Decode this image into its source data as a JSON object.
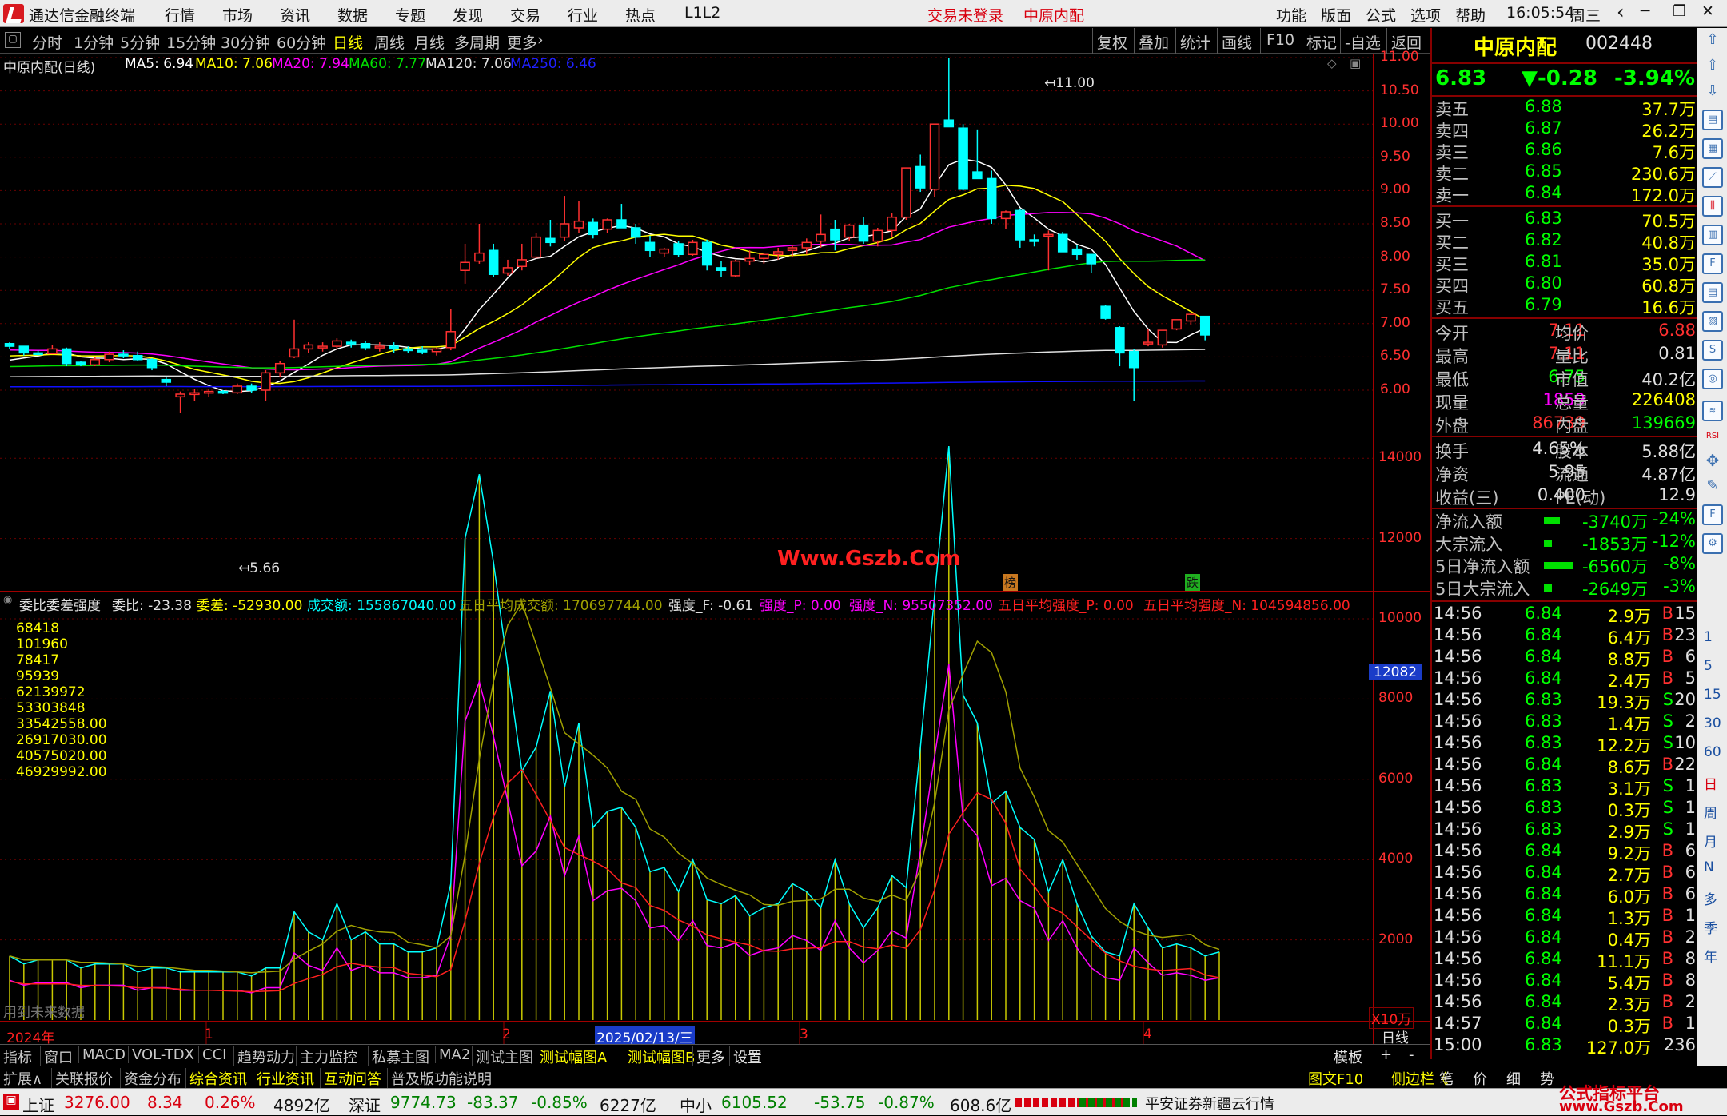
{
  "app": {
    "title": "通达信金融终端",
    "menu": [
      "行情",
      "市场",
      "资讯",
      "数据",
      "专题",
      "发现",
      "交易",
      "行业",
      "热点",
      "L1L2"
    ],
    "login": "交易未登录",
    "stock_tab": "中原内配",
    "right_menu": [
      "功能",
      "版面",
      "公式",
      "选项",
      "帮助"
    ],
    "time": "16:05:54",
    "weekday": "周三"
  },
  "periods": [
    "分时",
    "1分钟",
    "5分钟",
    "15分钟",
    "30分钟",
    "60分钟",
    "日线",
    "周线",
    "月线",
    "多周期",
    "更多"
  ],
  "tools": [
    "复权",
    "叠加",
    "统计",
    "画线",
    "F10",
    "标记",
    "-自选",
    "返回"
  ],
  "ma": {
    "name": "中原内配(日线)",
    "items": [
      {
        "t": "MA5: 6.94",
        "c": "#ffffff"
      },
      {
        "t": "MA10: 7.06",
        "c": "#ffff00"
      },
      {
        "t": "MA20: 7.94",
        "c": "#ff00ff"
      },
      {
        "t": "MA60: 7.77",
        "c": "#00e000"
      },
      {
        "t": "MA120: 7.06",
        "c": "#e0e0e0"
      },
      {
        "t": "MA250: 6.46",
        "c": "#1010ff"
      }
    ]
  },
  "price_axis": [
    "11.00",
    "10.50",
    "10.00",
    "9.50",
    "9.00",
    "8.50",
    "8.00",
    "7.50",
    "7.00",
    "6.50",
    "6.00"
  ],
  "annot": {
    "high": "11.00",
    "low": "5.66",
    "watermark": "Www.Gszb.Com",
    "mark1": "榜",
    "mark2": "跌"
  },
  "ind": {
    "name": "委比委差强度",
    "items": [
      {
        "t": "委比: -23.38",
        "c": "#e0e0e0"
      },
      {
        "t": "委差: -52930.00",
        "c": "#ffff00"
      },
      {
        "t": "成交额: 155867040.00",
        "c": "#00ffff"
      },
      {
        "t": "五日平均成交额: 170697744.00",
        "c": "#a0a000"
      },
      {
        "t": "强度_F: -0.61",
        "c": "#e0e0e0"
      },
      {
        "t": "强度_P: 0.00",
        "c": "#ff00ff"
      },
      {
        "t": "强度_N: 95507352.00",
        "c": "#ff00ff"
      },
      {
        "t": "五日平均强度_P: 0.00",
        "c": "#ff2020"
      },
      {
        "t": "五日平均强度_N: 104594856.00",
        "c": "#ff2020"
      }
    ]
  },
  "ind_values": [
    "68418",
    "101960",
    "78417",
    "95939",
    "62139972",
    "53303848",
    "33542558.00",
    "26917030.00",
    "40575020.00",
    "46929992.00"
  ],
  "vol_axis": [
    "14000",
    "12000",
    "10000",
    "8000",
    "6000",
    "4000",
    "2000"
  ],
  "vol_marker": "12082",
  "vol_unit": "X10万",
  "no_data": "用到未来数据",
  "date_axis": {
    "year": "2024年",
    "m1": "1",
    "m2": "2",
    "date": "2025/02/13/三",
    "m3": "3",
    "m4": "4",
    "period": "日线"
  },
  "stock": {
    "name": "中原内配",
    "code": "002448",
    "price": "6.83",
    "change": "▼-0.28",
    "pct": "-3.94%"
  },
  "asks": [
    [
      "卖五",
      "6.88",
      "37.7万"
    ],
    [
      "卖四",
      "6.87",
      "26.2万"
    ],
    [
      "卖三",
      "6.86",
      "7.6万"
    ],
    [
      "卖二",
      "6.85",
      "230.6万"
    ],
    [
      "卖一",
      "6.84",
      "172.0万"
    ]
  ],
  "bids": [
    [
      "买一",
      "6.83",
      "70.5万"
    ],
    [
      "买二",
      "6.82",
      "40.8万"
    ],
    [
      "买三",
      "6.81",
      "35.0万"
    ],
    [
      "买四",
      "6.80",
      "60.8万"
    ],
    [
      "买五",
      "6.79",
      "16.6万"
    ]
  ],
  "quote": [
    [
      "今开",
      "7.11",
      "均价",
      "6.88"
    ],
    [
      "最高",
      "7.11",
      "量比",
      "0.81"
    ],
    [
      "最低",
      "6.75",
      "市值",
      "40.2亿"
    ],
    [
      "现量",
      "1859",
      "总量",
      "226408"
    ],
    [
      "外盘",
      "86739",
      "内盘",
      "139669"
    ]
  ],
  "fund": [
    [
      "换手",
      "4.65%",
      "股本",
      "5.88亿"
    ],
    [
      "净资",
      "5.95",
      "流通",
      "4.87亿"
    ],
    [
      "收益(三)",
      "0.400",
      "PE(动)",
      "12.9"
    ]
  ],
  "flow": [
    [
      "净流入额",
      "-3740万",
      "-24%"
    ],
    [
      "大宗流入",
      "-1853万",
      "-12%"
    ],
    [
      "5日净流入额",
      "-6560万",
      "-8%"
    ],
    [
      "5日大宗流入",
      "-2649万",
      "-3%"
    ]
  ],
  "ticks": [
    [
      "14:56",
      "6.84",
      "2.9万",
      "B",
      "15"
    ],
    [
      "14:56",
      "6.84",
      "6.4万",
      "B",
      "23"
    ],
    [
      "14:56",
      "6.84",
      "8.8万",
      "B",
      "6"
    ],
    [
      "14:56",
      "6.84",
      "2.4万",
      "B",
      "5"
    ],
    [
      "14:56",
      "6.83",
      "19.3万",
      "S",
      "20"
    ],
    [
      "14:56",
      "6.83",
      "1.4万",
      "S",
      "2"
    ],
    [
      "14:56",
      "6.83",
      "12.2万",
      "S",
      "10"
    ],
    [
      "14:56",
      "6.84",
      "8.6万",
      "B",
      "22"
    ],
    [
      "14:56",
      "6.83",
      "3.1万",
      "S",
      "1"
    ],
    [
      "14:56",
      "6.83",
      "0.3万",
      "S",
      "1"
    ],
    [
      "14:56",
      "6.83",
      "2.9万",
      "S",
      "1"
    ],
    [
      "14:56",
      "6.84",
      "9.2万",
      "B",
      "6"
    ],
    [
      "14:56",
      "6.84",
      "2.7万",
      "B",
      "6"
    ],
    [
      "14:56",
      "6.84",
      "6.0万",
      "B",
      "6"
    ],
    [
      "14:56",
      "6.84",
      "1.3万",
      "B",
      "1"
    ],
    [
      "14:56",
      "6.84",
      "0.4万",
      "B",
      "2"
    ],
    [
      "14:56",
      "6.84",
      "11.1万",
      "B",
      "8"
    ],
    [
      "14:56",
      "6.84",
      "5.4万",
      "B",
      "8"
    ],
    [
      "14:56",
      "6.84",
      "2.3万",
      "B",
      "2"
    ],
    [
      "14:57",
      "6.84",
      "0.3万",
      "B",
      "1"
    ],
    [
      "15:00",
      "6.83",
      "127.0万",
      "",
      "236"
    ]
  ],
  "bottom_tabs": [
    "指标",
    "窗口",
    "MACD",
    "VOL-TDX",
    "CCI",
    "趋势动力",
    "主力监控",
    "私募主图",
    "MA2",
    "测试主图",
    "测试幅图A",
    "测试幅图B",
    "更多",
    "设置"
  ],
  "bottom_right": [
    "模板",
    "+",
    "-"
  ],
  "info_tabs": [
    "扩展∧",
    "关联报价",
    "资金分布",
    "综合资讯",
    "行业资讯",
    "互动问答",
    "普及版功能说明"
  ],
  "info_right": [
    "图文F10",
    "侧边栏《",
    "笔",
    "价",
    "细",
    "势"
  ],
  "status": {
    "sh_name": "上证",
    "sh": "3276.00",
    "sh_chg": "8.34",
    "sh_pct": "0.26%",
    "sh_amt": "4892亿",
    "sz_name": "深证",
    "sz": "9774.73",
    "sz_chg": "-83.37",
    "sz_pct": "-0.85%",
    "sz_amt": "6227亿",
    "zx_name": "中小",
    "zx": "6105.52",
    "zx_chg": "-53.75",
    "zx_pct": "-0.87%",
    "zx_amt": "608.6亿",
    "broker": "平安证券新疆云行情",
    "brand1": "公式指标平台",
    "brand2": "www.Gszb.Com"
  },
  "right_keys": [
    "1",
    "5",
    "15",
    "30",
    "60",
    "日",
    "周",
    "月",
    "N",
    "多",
    "季",
    "年"
  ],
  "chart_data": {
    "type": "candlestick",
    "timeframe": "日线",
    "y_range": [
      5.6,
      11.1
    ],
    "candles": [
      [
        6.7,
        6.72,
        6.62,
        6.66
      ],
      [
        6.66,
        6.66,
        6.52,
        6.56
      ],
      [
        6.56,
        6.6,
        6.52,
        6.55
      ],
      [
        6.55,
        6.68,
        6.54,
        6.62
      ],
      [
        6.62,
        6.64,
        6.36,
        6.4
      ],
      [
        6.42,
        6.44,
        6.36,
        6.38
      ],
      [
        6.38,
        6.5,
        6.36,
        6.46
      ],
      [
        6.46,
        6.58,
        6.42,
        6.54
      ],
      [
        6.54,
        6.6,
        6.48,
        6.52
      ],
      [
        6.52,
        6.58,
        6.44,
        6.46
      ],
      [
        6.46,
        6.48,
        6.3,
        6.34
      ],
      [
        6.16,
        6.2,
        6.06,
        6.12
      ],
      [
        5.9,
        5.98,
        5.66,
        5.94
      ],
      [
        5.94,
        6.02,
        5.84,
        5.96
      ],
      [
        5.96,
        6.02,
        5.9,
        5.98
      ],
      [
        5.98,
        6.0,
        5.94,
        5.96
      ],
      [
        5.96,
        6.1,
        5.94,
        6.06
      ],
      [
        6.06,
        6.1,
        5.96,
        6.0
      ],
      [
        6.0,
        6.3,
        5.84,
        6.26
      ],
      [
        6.26,
        6.44,
        6.2,
        6.4
      ],
      [
        6.5,
        7.06,
        6.48,
        6.62
      ],
      [
        6.62,
        6.72,
        6.56,
        6.68
      ],
      [
        6.64,
        6.72,
        6.58,
        6.66
      ],
      [
        6.66,
        6.78,
        6.62,
        6.74
      ],
      [
        6.72,
        6.76,
        6.64,
        6.7
      ],
      [
        6.7,
        6.74,
        6.6,
        6.64
      ],
      [
        6.64,
        6.72,
        6.58,
        6.66
      ],
      [
        6.66,
        6.72,
        6.56,
        6.62
      ],
      [
        6.62,
        6.66,
        6.56,
        6.6
      ],
      [
        6.6,
        6.66,
        6.54,
        6.58
      ],
      [
        6.58,
        6.64,
        6.52,
        6.62
      ],
      [
        6.64,
        7.22,
        6.6,
        6.88
      ],
      [
        7.8,
        8.2,
        7.6,
        7.92
      ],
      [
        7.94,
        8.5,
        7.9,
        8.06
      ],
      [
        8.1,
        8.2,
        7.7,
        7.74
      ],
      [
        7.76,
        7.96,
        7.72,
        7.84
      ],
      [
        7.86,
        8.2,
        7.8,
        7.96
      ],
      [
        8.0,
        8.36,
        7.98,
        8.3
      ],
      [
        8.28,
        8.56,
        8.16,
        8.22
      ],
      [
        8.3,
        8.92,
        8.24,
        8.5
      ],
      [
        8.44,
        8.84,
        8.36,
        8.54
      ],
      [
        8.52,
        8.58,
        8.28,
        8.34
      ],
      [
        8.42,
        8.58,
        8.36,
        8.56
      ],
      [
        8.56,
        8.8,
        8.44,
        8.44
      ],
      [
        8.44,
        8.5,
        8.2,
        8.3
      ],
      [
        8.22,
        8.32,
        8.0,
        8.1
      ],
      [
        8.06,
        8.14,
        8.0,
        8.12
      ],
      [
        8.2,
        8.24,
        8.0,
        8.04
      ],
      [
        8.04,
        8.26,
        8.02,
        8.22
      ],
      [
        8.22,
        8.26,
        7.8,
        7.88
      ],
      [
        7.84,
        7.94,
        7.7,
        7.8
      ],
      [
        7.72,
        7.96,
        7.7,
        7.94
      ],
      [
        7.94,
        8.1,
        7.88,
        7.98
      ],
      [
        7.98,
        8.06,
        7.9,
        8.04
      ],
      [
        8.04,
        8.14,
        7.96,
        8.08
      ],
      [
        8.1,
        8.18,
        8.0,
        8.14
      ],
      [
        8.14,
        8.28,
        8.04,
        8.22
      ],
      [
        8.24,
        8.64,
        8.14,
        8.34
      ],
      [
        8.42,
        8.56,
        8.1,
        8.26
      ],
      [
        8.3,
        8.5,
        8.24,
        8.48
      ],
      [
        8.48,
        8.6,
        8.2,
        8.24
      ],
      [
        8.24,
        8.44,
        8.16,
        8.4
      ],
      [
        8.4,
        8.66,
        8.3,
        8.6
      ],
      [
        8.6,
        9.34,
        8.56,
        9.34
      ],
      [
        9.36,
        9.54,
        8.98,
        9.04
      ],
      [
        9.02,
        10.0,
        8.9,
        10.0
      ],
      [
        10.06,
        11.0,
        9.96,
        9.96
      ],
      [
        9.94,
        10.0,
        9.0,
        9.02
      ],
      [
        9.28,
        9.92,
        9.18,
        9.18
      ],
      [
        9.18,
        9.3,
        8.5,
        8.58
      ],
      [
        8.58,
        8.7,
        8.42,
        8.68
      ],
      [
        8.7,
        8.72,
        8.14,
        8.26
      ],
      [
        8.26,
        8.34,
        8.16,
        8.24
      ],
      [
        8.32,
        8.4,
        7.8,
        8.34
      ],
      [
        8.34,
        8.38,
        8.08,
        8.08
      ],
      [
        8.12,
        8.18,
        7.96,
        8.04
      ],
      [
        8.04,
        8.04,
        7.76,
        7.9
      ],
      [
        7.26,
        7.28,
        7.06,
        7.08
      ],
      [
        6.94,
        6.96,
        6.36,
        6.56
      ],
      [
        6.58,
        6.62,
        5.84,
        6.34
      ],
      [
        6.72,
        6.92,
        6.66,
        6.72
      ],
      [
        6.68,
        6.9,
        6.64,
        6.9
      ],
      [
        6.92,
        7.06,
        6.9,
        7.06
      ],
      [
        7.04,
        7.14,
        6.98,
        7.14
      ],
      [
        7.11,
        7.11,
        6.75,
        6.83
      ]
    ],
    "volume_x10wan": [
      1600,
      1400,
      1500,
      1500,
      1500,
      1300,
      1400,
      1400,
      1400,
      1200,
      1300,
      1300,
      1200,
      1200,
      1200,
      1200,
      1200,
      1100,
      1300,
      1300,
      2700,
      2200,
      2000,
      2900,
      2000,
      2200,
      1900,
      1900,
      1700,
      1700,
      1800,
      3400,
      12000,
      13600,
      11400,
      8800,
      6200,
      6800,
      8200,
      5800,
      7400,
      4800,
      5200,
      5300,
      4800,
      3700,
      3800,
      3200,
      4000,
      3000,
      2900,
      3100,
      2600,
      2800,
      2900,
      3400,
      3200,
      2800,
      4000,
      2900,
      2300,
      2800,
      3600,
      3300,
      6800,
      10600,
      14300,
      8100,
      7400,
      5400,
      5700,
      4800,
      4500,
      3200,
      4000,
      2900,
      2100,
      1700,
      1600,
      2900,
      2300,
      1800,
      1900,
      1800,
      1600,
      1700
    ],
    "ma_series_names": [
      "MA5",
      "MA10",
      "MA20",
      "MA60",
      "MA120",
      "MA250"
    ]
  }
}
